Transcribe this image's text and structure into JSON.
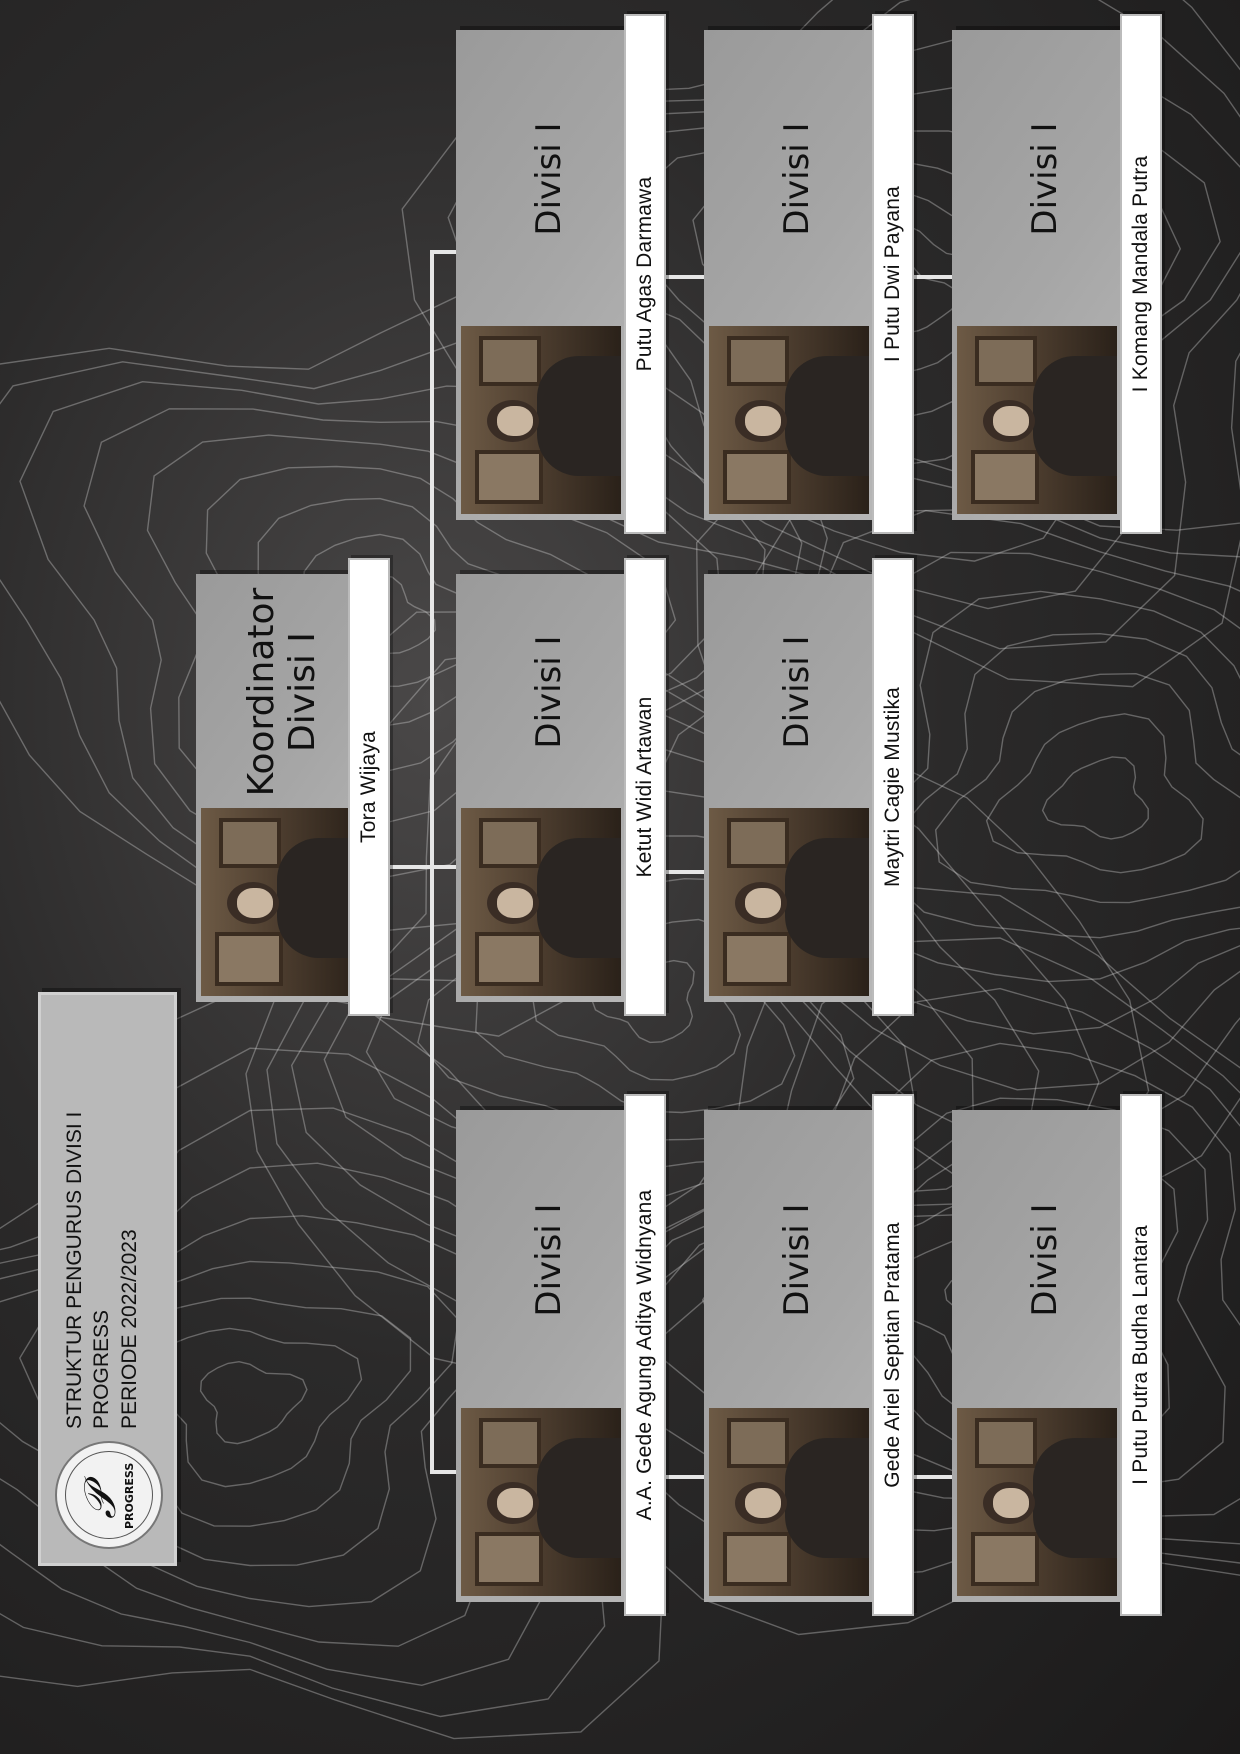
{
  "header": {
    "line1": "STRUKTUR PENGURUS DIVISI I",
    "line2": "PROGRESS",
    "line3": "PERIODE 2022/2023",
    "logo_text": "PROGRESS"
  },
  "coordinator": {
    "title": "Koordinator\nDivisi I",
    "name": "Tora Wijaya"
  },
  "members": [
    {
      "title": "Divisi I",
      "name": "A.A. Gede Agung Aditya Widnyana"
    },
    {
      "title": "Divisi I",
      "name": "Gede Ariel Septian Pratama"
    },
    {
      "title": "Divisi I",
      "name": "I Putu Putra Budha Lantara"
    },
    {
      "title": "Divisi I",
      "name": "Ketut Widi Artawan"
    },
    {
      "title": "Divisi I",
      "name": "Maytri Cagie Mustika"
    },
    {
      "title": "Divisi I",
      "name": "Putu Agas Darmawa"
    },
    {
      "title": "Divisi I",
      "name": "I Putu Dwi Payana"
    },
    {
      "title": "Divisi I",
      "name": "I Komang Mandala Putra"
    }
  ],
  "colors": {
    "background": "#2b2a2a",
    "card": "#a8a8a8",
    "namebar": "#ffffff",
    "lines": "#e6e6e6"
  }
}
